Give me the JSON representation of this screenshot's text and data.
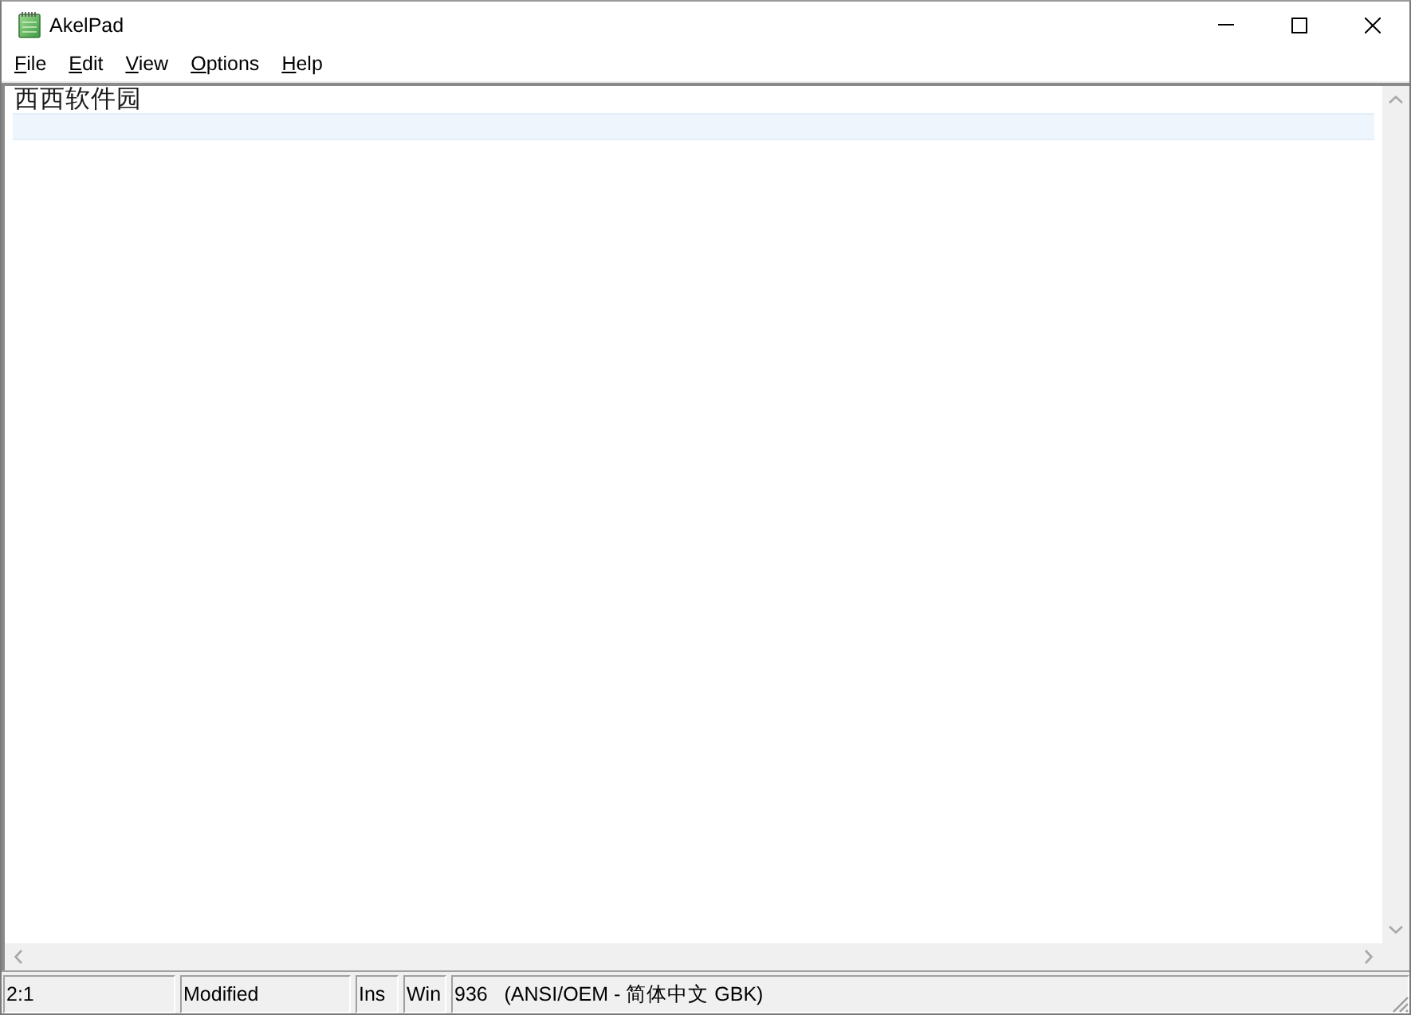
{
  "window": {
    "title": "AkelPad"
  },
  "menu": {
    "mnemonics": true,
    "items": [
      "File",
      "Edit",
      "View",
      "Options",
      "Help"
    ]
  },
  "editor": {
    "lines": [
      {
        "text": "西西软件园",
        "current": false
      },
      {
        "current": true
      }
    ]
  },
  "status_bar": {
    "panels": [
      "2:1",
      "Modified",
      "Ins",
      "Win",
      "936   (ANSI/OEM - 简体中文 GBK)"
    ]
  }
}
